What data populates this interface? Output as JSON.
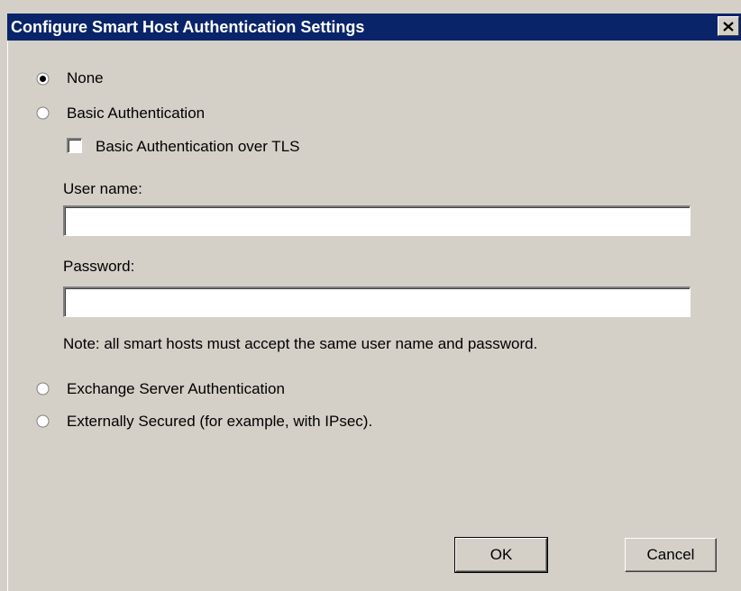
{
  "window": {
    "title": "Configure Smart Host Authentication Settings",
    "close_glyph": "✕"
  },
  "auth": {
    "none_label": "None",
    "none_selected": true,
    "basic_label": "Basic Authentication",
    "basic_selected": false,
    "basic_tls_label": "Basic Authentication over TLS",
    "basic_tls_checked": false,
    "username_label": "User name:",
    "username_value": "",
    "password_label": "Password:",
    "password_value": "",
    "note": "Note: all smart hosts must accept the same user name and password.",
    "exchange_label": "Exchange Server Authentication",
    "exchange_selected": false,
    "external_label": "Externally Secured (for example, with IPsec).",
    "external_selected": false
  },
  "buttons": {
    "ok_label": "OK",
    "cancel_label": "Cancel"
  }
}
